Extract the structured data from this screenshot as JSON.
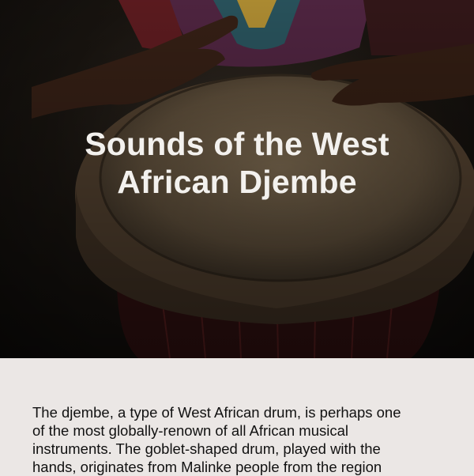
{
  "hero": {
    "title_line1": "Sounds of the West",
    "title_line2": "African Djembe"
  },
  "intro": {
    "line1": "The djembe, a type of West African drum, is perhaps one",
    "line2": "of the most globally-renown of all African musical",
    "line3": "instruments. The goblet-shaped drum, played with the",
    "line4": "hands, originates from Malinke people from the region"
  }
}
